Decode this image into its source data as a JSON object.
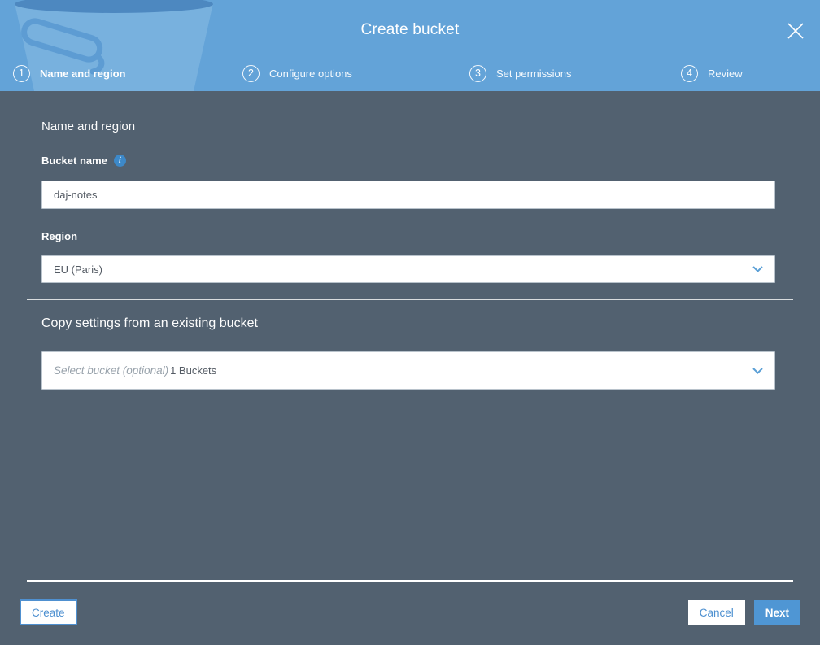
{
  "header": {
    "title": "Create bucket",
    "steps": [
      {
        "number": "1",
        "label": "Name and region",
        "active": true
      },
      {
        "number": "2",
        "label": "Configure options",
        "active": false
      },
      {
        "number": "3",
        "label": "Set permissions",
        "active": false
      },
      {
        "number": "4",
        "label": "Review",
        "active": false
      }
    ]
  },
  "form": {
    "section_heading": "Name and region",
    "bucket_name_label": "Bucket name",
    "bucket_name_value": "daj-notes",
    "region_label": "Region",
    "region_value": "EU (Paris)",
    "copy_heading": "Copy settings from an existing bucket",
    "copy_placeholder": "Select bucket (optional)",
    "copy_count": "1 Buckets"
  },
  "footer": {
    "create_label": "Create",
    "cancel_label": "Cancel",
    "next_label": "Next"
  },
  "icons": {
    "close_icon": "x-cross",
    "info_icon": "i-circle",
    "chevron_down_icon": "v-chevron",
    "bucket_watermark": "s3-bucket"
  },
  "colors": {
    "header_blue": "#63a3d8",
    "body_background": "#526170",
    "accent_blue": "#4c8fd0",
    "next_button_blue": "#4f96d4",
    "input_text": "#545b64"
  }
}
